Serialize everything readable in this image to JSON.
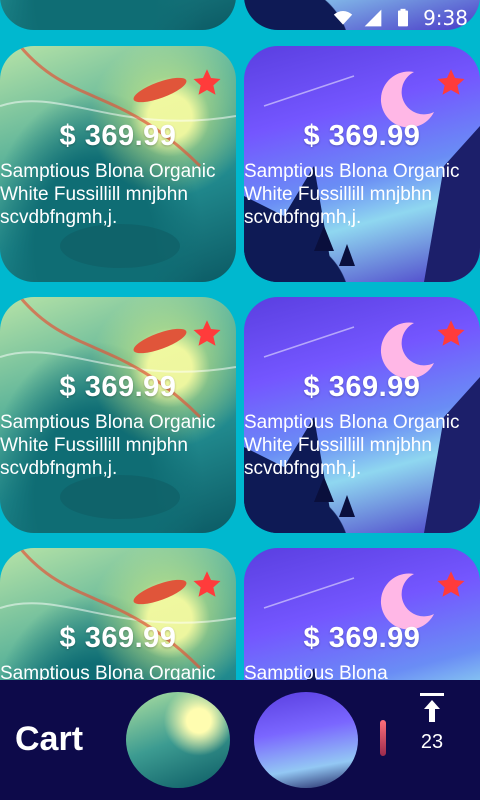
{
  "status_bar": {
    "time": "9:38"
  },
  "products": [
    {
      "price": "$ 369.99",
      "description": "Samptious Blona Organic White Fussillill mnjbhn scvdbfngmh,j.",
      "image": "forest-river-art"
    },
    {
      "price": "$ 369.99",
      "description": "Samptious Blona Organic White Fussillill mnjbhn scvdbfngmh,j.",
      "image": "moon-night-art"
    },
    {
      "price": "$ 369.99",
      "description": "Samptious Blona Organic White Fussillill mnjbhn scvdbfngmh,j.",
      "image": "forest-river-art"
    },
    {
      "price": "$ 369.99",
      "description": "Samptious Blona Organic White Fussillill mnjbhn scvdbfngmh,j.",
      "image": "moon-night-art"
    },
    {
      "price": "$ 369.99",
      "description": "Samptious Blona Organic White Fussillill mnjbhn scvdbfngmh,j.",
      "image": "forest-river-art"
    },
    {
      "price": "$ 369.99",
      "description": "Samptious Blona",
      "image": "moon-night-art"
    }
  ],
  "bottom_bar": {
    "cart_label": "Cart",
    "cart_count": "23"
  },
  "colors": {
    "background": "#00b8cf",
    "bottom_bar": "#0d0a4a",
    "star": "#ff3b3b"
  },
  "icons": [
    "wifi-icon",
    "signal-icon",
    "battery-icon",
    "star-icon",
    "scroll-to-top-icon"
  ]
}
